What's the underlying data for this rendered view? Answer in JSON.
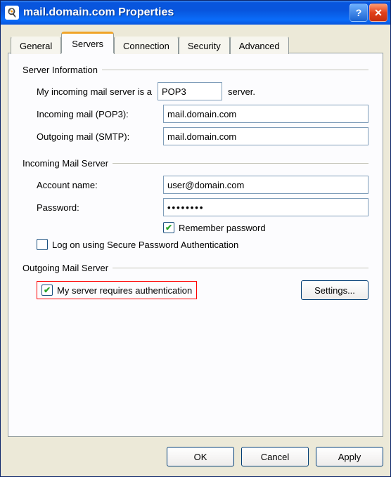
{
  "window": {
    "title": "mail.domain.com Properties",
    "app_icon_glyph": "🍳"
  },
  "tabs": {
    "general": "General",
    "servers": "Servers",
    "connection": "Connection",
    "security": "Security",
    "advanced": "Advanced"
  },
  "server_info": {
    "group_label": "Server Information",
    "incoming_type_label": "My incoming mail server is a",
    "incoming_type_value": "POP3",
    "incoming_type_suffix": "server.",
    "incoming_label": "Incoming mail (POP3):",
    "incoming_value": "mail.domain.com",
    "outgoing_label": "Outgoing mail (SMTP):",
    "outgoing_value": "mail.domain.com"
  },
  "incoming_server": {
    "group_label": "Incoming Mail Server",
    "account_label": "Account name:",
    "account_value": "user@domain.com",
    "password_label": "Password:",
    "password_value": "••••••••",
    "remember_label": "Remember password",
    "remember_checked": true,
    "spa_label": "Log on using Secure Password Authentication",
    "spa_checked": false
  },
  "outgoing_server": {
    "group_label": "Outgoing Mail Server",
    "auth_label": "My server requires authentication",
    "auth_checked": true,
    "settings_button": "Settings..."
  },
  "buttons": {
    "ok": "OK",
    "cancel": "Cancel",
    "apply": "Apply"
  }
}
